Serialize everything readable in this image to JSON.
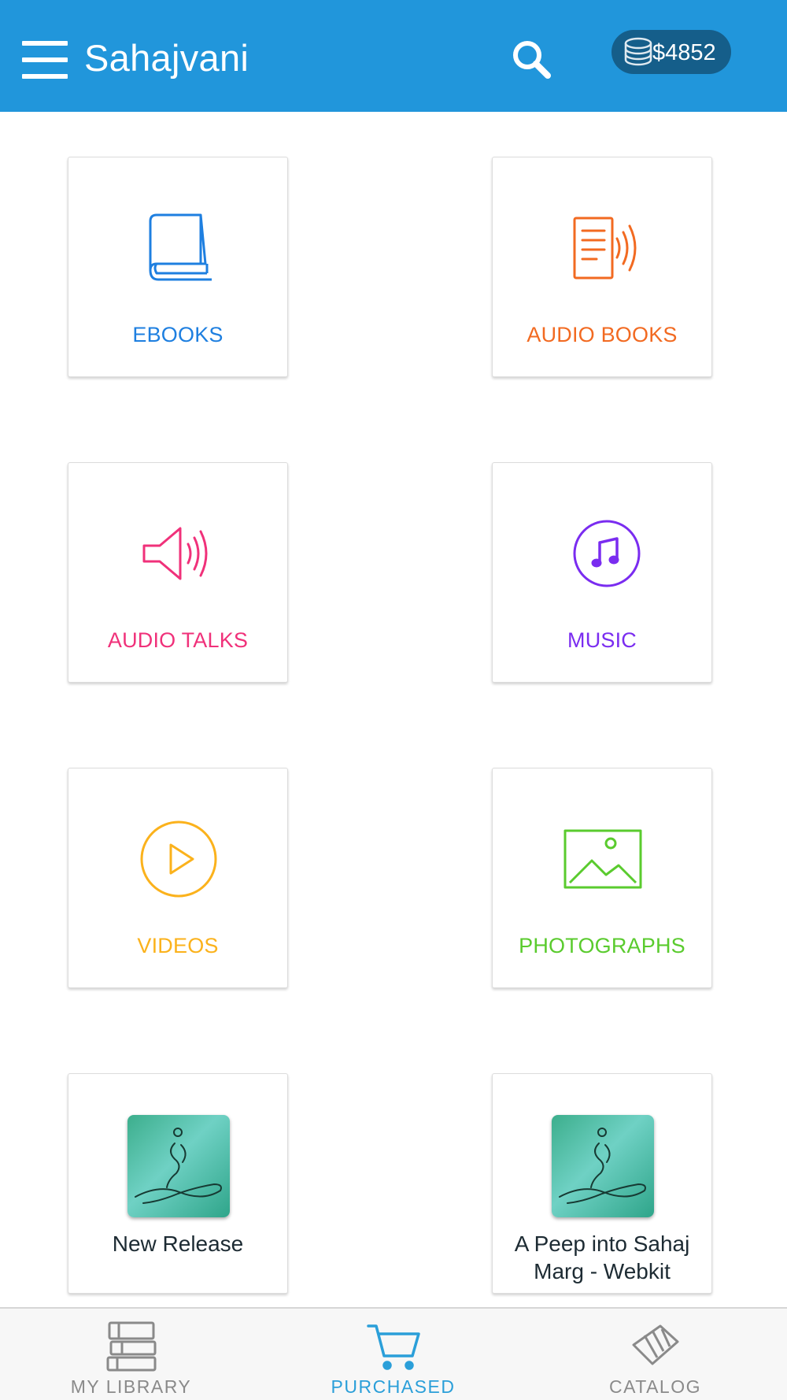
{
  "header": {
    "title": "Sahajvani",
    "wallet_amount": "$4852",
    "menu_icon": "hamburger-menu-icon",
    "search_icon": "search-icon",
    "wallet_icon": "coins-stack-icon",
    "background_color": "#2196db"
  },
  "categories": [
    {
      "label": "EBOOKS",
      "icon": "book-icon",
      "color": "#1e7fe0"
    },
    {
      "label": "AUDIO BOOKS",
      "icon": "audiobook-icon",
      "color": "#f26a21"
    },
    {
      "label": "AUDIO TALKS",
      "icon": "speaker-icon",
      "color": "#f0317a"
    },
    {
      "label": "MUSIC",
      "icon": "music-note-icon",
      "color": "#7a2cf0"
    },
    {
      "label": "VIDEOS",
      "icon": "play-circle-icon",
      "color": "#fbb21c"
    },
    {
      "label": "PHOTOGRAPHS",
      "icon": "image-icon",
      "color": "#5acb2e"
    }
  ],
  "books": [
    {
      "title": "New Release",
      "icon": "meditation-figure-icon"
    },
    {
      "title": "A Peep into Sahaj Marg - Webkit",
      "icon": "meditation-figure-icon"
    }
  ],
  "bottom_nav": {
    "items": [
      {
        "label": "MY LIBRARY",
        "icon": "books-stack-icon",
        "active": false
      },
      {
        "label": "PURCHASED",
        "icon": "shopping-cart-icon",
        "active": true
      },
      {
        "label": "CATALOG",
        "icon": "catalog-cards-icon",
        "active": false
      }
    ],
    "active_color": "#2b9fd9",
    "inactive_color": "#8a8a8a"
  }
}
